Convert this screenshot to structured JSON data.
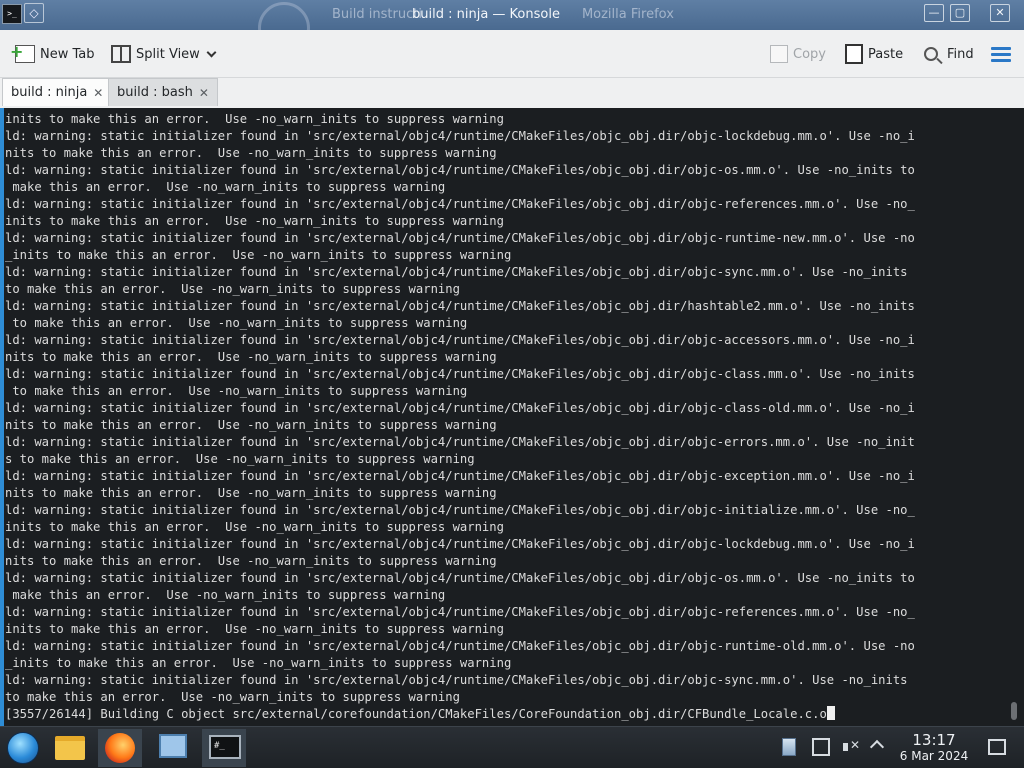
{
  "window": {
    "ghost_title": "Build instructi",
    "title": "build : ninja — Konsole",
    "background_suffix": "Mozilla Firefox",
    "minimize_glyph": "—",
    "maximize_glyph": "▢",
    "close_glyph": "✕",
    "app_icon_text": ">_",
    "pin_glyph": "◇"
  },
  "toolbar": {
    "new_tab": "New Tab",
    "split_view": "Split View",
    "copy": "Copy",
    "paste": "Paste",
    "find": "Find"
  },
  "tabs": [
    {
      "label": "build : ninja",
      "close": "✕"
    },
    {
      "label": "build : bash",
      "close": "✕"
    }
  ],
  "terminal": {
    "lines": [
      "inits to make this an error.  Use -no_warn_inits to suppress warning",
      "ld: warning: static initializer found in 'src/external/objc4/runtime/CMakeFiles/objc_obj.dir/objc-lockdebug.mm.o'. Use -no_i",
      "nits to make this an error.  Use -no_warn_inits to suppress warning",
      "ld: warning: static initializer found in 'src/external/objc4/runtime/CMakeFiles/objc_obj.dir/objc-os.mm.o'. Use -no_inits to",
      " make this an error.  Use -no_warn_inits to suppress warning",
      "ld: warning: static initializer found in 'src/external/objc4/runtime/CMakeFiles/objc_obj.dir/objc-references.mm.o'. Use -no_",
      "inits to make this an error.  Use -no_warn_inits to suppress warning",
      "ld: warning: static initializer found in 'src/external/objc4/runtime/CMakeFiles/objc_obj.dir/objc-runtime-new.mm.o'. Use -no",
      "_inits to make this an error.  Use -no_warn_inits to suppress warning",
      "ld: warning: static initializer found in 'src/external/objc4/runtime/CMakeFiles/objc_obj.dir/objc-sync.mm.o'. Use -no_inits",
      "to make this an error.  Use -no_warn_inits to suppress warning",
      "ld: warning: static initializer found in 'src/external/objc4/runtime/CMakeFiles/objc_obj.dir/hashtable2.mm.o'. Use -no_inits",
      " to make this an error.  Use -no_warn_inits to suppress warning",
      "ld: warning: static initializer found in 'src/external/objc4/runtime/CMakeFiles/objc_obj.dir/objc-accessors.mm.o'. Use -no_i",
      "nits to make this an error.  Use -no_warn_inits to suppress warning",
      "ld: warning: static initializer found in 'src/external/objc4/runtime/CMakeFiles/objc_obj.dir/objc-class.mm.o'. Use -no_inits",
      " to make this an error.  Use -no_warn_inits to suppress warning",
      "ld: warning: static initializer found in 'src/external/objc4/runtime/CMakeFiles/objc_obj.dir/objc-class-old.mm.o'. Use -no_i",
      "nits to make this an error.  Use -no_warn_inits to suppress warning",
      "ld: warning: static initializer found in 'src/external/objc4/runtime/CMakeFiles/objc_obj.dir/objc-errors.mm.o'. Use -no_init",
      "s to make this an error.  Use -no_warn_inits to suppress warning",
      "ld: warning: static initializer found in 'src/external/objc4/runtime/CMakeFiles/objc_obj.dir/objc-exception.mm.o'. Use -no_i",
      "nits to make this an error.  Use -no_warn_inits to suppress warning",
      "ld: warning: static initializer found in 'src/external/objc4/runtime/CMakeFiles/objc_obj.dir/objc-initialize.mm.o'. Use -no_",
      "inits to make this an error.  Use -no_warn_inits to suppress warning",
      "ld: warning: static initializer found in 'src/external/objc4/runtime/CMakeFiles/objc_obj.dir/objc-lockdebug.mm.o'. Use -no_i",
      "nits to make this an error.  Use -no_warn_inits to suppress warning",
      "ld: warning: static initializer found in 'src/external/objc4/runtime/CMakeFiles/objc_obj.dir/objc-os.mm.o'. Use -no_inits to",
      " make this an error.  Use -no_warn_inits to suppress warning",
      "ld: warning: static initializer found in 'src/external/objc4/runtime/CMakeFiles/objc_obj.dir/objc-references.mm.o'. Use -no_",
      "inits to make this an error.  Use -no_warn_inits to suppress warning",
      "ld: warning: static initializer found in 'src/external/objc4/runtime/CMakeFiles/objc_obj.dir/objc-runtime-old.mm.o'. Use -no",
      "_inits to make this an error.  Use -no_warn_inits to suppress warning",
      "ld: warning: static initializer found in 'src/external/objc4/runtime/CMakeFiles/objc_obj.dir/objc-sync.mm.o'. Use -no_inits",
      "to make this an error.  Use -no_warn_inits to suppress warning",
      "[3557/26144] Building C object src/external/corefoundation/CMakeFiles/CoreFoundation_obj.dir/CFBundle_Locale.c.o"
    ]
  },
  "taskbar": {
    "items": [
      "start-menu",
      "file-manager",
      "firefox",
      "system-settings",
      "konsole"
    ],
    "console_icon_text": "#_",
    "clock": {
      "time": "13:17",
      "date": "6 Mar 2024"
    }
  },
  "colors": {
    "terminal_bg": "#1b1e21",
    "terminal_fg": "#dcdcdc",
    "accent": "#2e8dd6",
    "titlebar": "#5f7fa4"
  }
}
